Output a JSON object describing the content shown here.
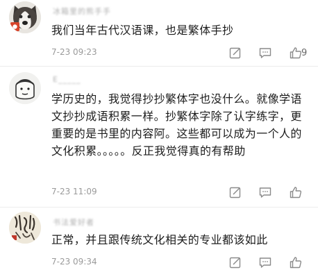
{
  "comments": [
    {
      "username": "冰箱里的熊手手",
      "text": "我们当年古代汉语课，也是繁体手抄",
      "time": "7-23 09:23",
      "likes": "9",
      "avatar_icon": "husky-dog-avatar"
    },
    {
      "username": "E_____",
      "text": "学历史的，我觉得抄抄繁体字也没什么。就像学语文抄抄成语积累一样。抄繁体字除了认字练字，更重要的是书里的内容阿。这些都可以成为一个人的文化积累。。。。。反正我觉得真的有帮助",
      "time": "7-23 11:09",
      "likes": "",
      "avatar_icon": "cartoon-face-avatar"
    },
    {
      "username": "书法爱好者",
      "text": "正常，并且跟传统文化相关的专业都该如此",
      "time": "7-23 09:34",
      "likes": "",
      "avatar_icon": "calligraphy-avatar"
    }
  ],
  "colors": {
    "text": "#1c1c1c",
    "meta": "#9a9a9a",
    "icon": "#8a8a8a"
  }
}
